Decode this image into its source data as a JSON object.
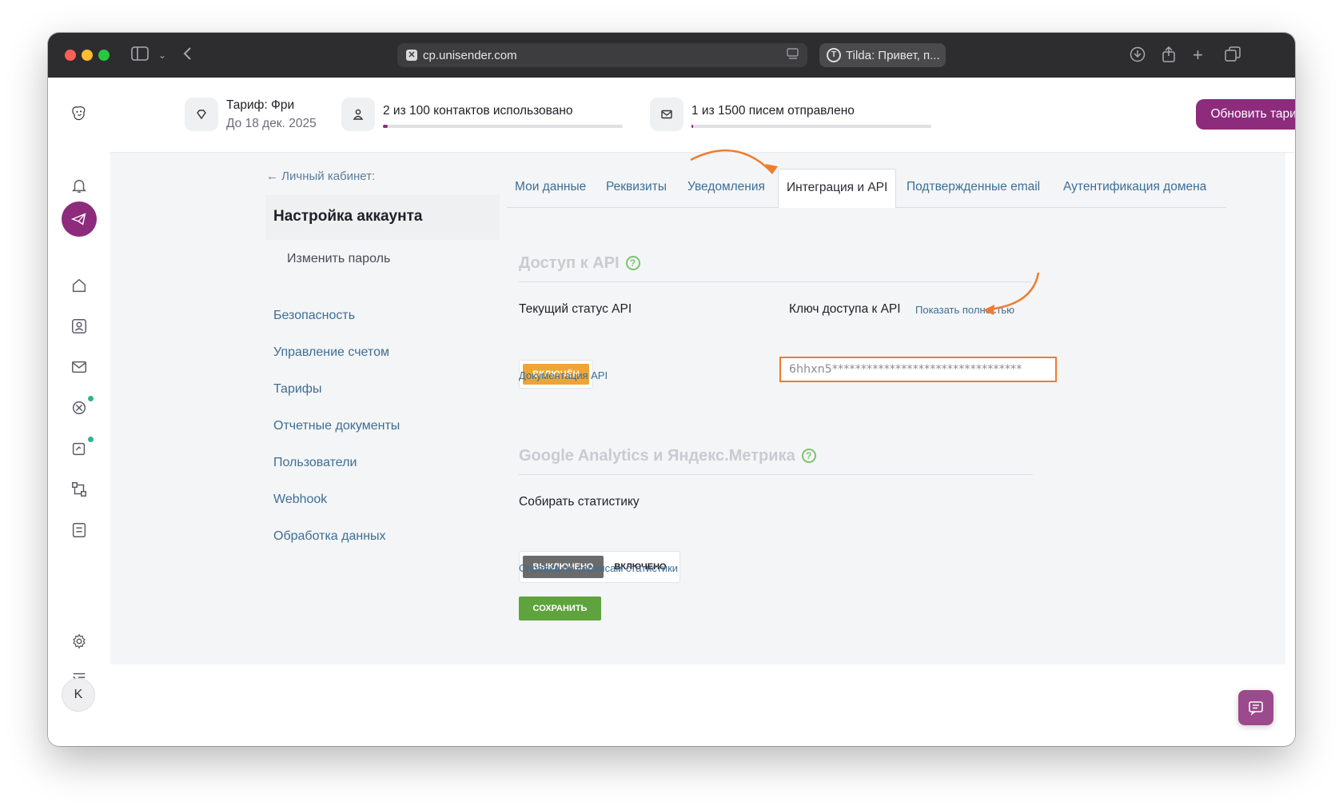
{
  "browser": {
    "url": "cp.unisender.com",
    "second_tab": "Tilda: Привет, п..."
  },
  "topbar": {
    "plan_title": "Тариф: Фри",
    "plan_until": "До 18 дек. 2025",
    "contacts_text": "2 из 100 контактов использовано",
    "contacts_used": 2,
    "contacts_total": 100,
    "emails_text": "1 из 1500 писем отправлено",
    "emails_sent": 1,
    "emails_total": 1500,
    "upgrade_label": "Обновить тариф"
  },
  "sidebar_nav": {
    "avatar_letter": "K"
  },
  "settings_menu": {
    "back_label": "← Личный кабинет:",
    "title": "Настройка аккаунта",
    "change_password": "Изменить пароль",
    "items": [
      "Безопасность",
      "Управление счетом",
      "Тарифы",
      "Отчетные документы",
      "Пользователи",
      "Webhook",
      "Обработка данных"
    ]
  },
  "tabs": [
    "Мои данные",
    "Реквизиты",
    "Уведомления",
    "Интеграция и API",
    "Подтвержденные email",
    "Аутентификация домена"
  ],
  "api_section": {
    "title": "Доступ к API",
    "status_label": "Текущий статус API",
    "status_badge": "ВКЛЮЧЁН",
    "docs_link": "Документация API",
    "key_label": "Ключ доступа к API",
    "show_full_link": "Показать полностью",
    "key_value": "6hhxn5*********************************"
  },
  "analytics_section": {
    "title": "Google Analytics и Яндекс.Метрика",
    "collect_label": "Собирать статистику",
    "toggle_off": "ВЫКЛЮЧЕНО",
    "toggle_on": "ВКЛЮЧЕНО",
    "help_link": "Справка по сервисам статистики",
    "save_label": "СОХРАНИТЬ"
  },
  "colors": {
    "brand": "#8d2b7c",
    "annotation": "#ef7c2e",
    "badge_on": "#eea537",
    "save": "#5ea33d"
  }
}
